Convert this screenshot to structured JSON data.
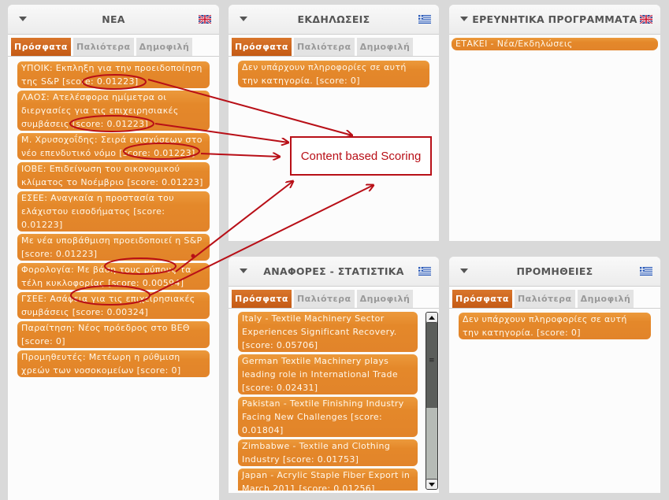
{
  "tabs": [
    "Πρόσφατα",
    "Παλιότερα",
    "Δημοφιλή"
  ],
  "colors": {
    "accent_orange": "#e4882a",
    "active_tab": "#c45a15",
    "annotation_red": "#b80f17"
  },
  "panels": {
    "news": {
      "title": "ΝΕΑ",
      "language_flag": "uk-flag",
      "items": [
        "ΥΠΟΙΚ: Εκπληξη για την προειδοποίηση της S&P [score: 0.01223]",
        "ΛΑΟΣ: Ατελέσφορα ημίμετρα οι διεργασίες για τις επιχειρησιακές συμβάσεις [score: 0.01223]",
        "Μ. Χρυσοχοΐδης: Σειρά ενισχύσεων στο νέο επενδυτικό νόμο [score: 0.01223]",
        "ΙΟΒΕ: Επιδείνωση του οικονομικού κλίματος το Νοέμβριο [score: 0.01223]",
        "ΕΣΕΕ: Αναγκαία η προστασία του ελάχιστου εισοδήματος  [score: 0.01223]",
        "Με νέα υποβάθμιση προειδοποιεί η S&P [score: 0.01223]",
        "Φορολογία: Με βάση τους ρύπους τα τέλη κυκλοφορίας [score: 0.00594]",
        "ΓΣΕΕ: Ασάφεια για τις επιχειρησιακές συμβάσεις [score: 0.00324]",
        "Παραίτηση: Νέος πρόεδρος στο ΒΕΘ [score: 0]",
        "Προμηθευτές: Μετέωρη η ρύθμιση χρεών των νοσοκομείων [score: 0]"
      ]
    },
    "events": {
      "title": "ΕΚΔΗΛΩΣΕΙΣ",
      "language_flag": "greek-flag",
      "items": [
        "Δεν υπάρχουν πληροφορίες σε αυτή την κατηγορία. [score: 0]"
      ]
    },
    "research": {
      "title": "ΕΡΕΥΝΗΤΙΚΑ ΠΡΟΓΡΑΜΜΑΤΑ",
      "language_flag": "uk-flag",
      "items": [
        "ΕΤΑΚΕΙ - Νέα/Εκδηλώσεις"
      ]
    },
    "reports": {
      "title": "ΑΝΑΦΟΡΕΣ - ΣΤΑΤΙΣΤΙΚΑ",
      "language_flag": "greek-flag",
      "items": [
        "Italy - Textile Machinery Sector Experiences Significant Recovery. [score: 0.05706]",
        "German Textile Machinery plays leading role in International Trade [score: 0.02431]",
        "Pakistan - Textile Finishing Industry Facing New Challenges [score: 0.01804]",
        "Zimbabwe - Textile and Clothing Industry [score: 0.01753]",
        "Japan - Acrylic Staple Fiber Export in March 2011 [score: 0.01256]"
      ]
    },
    "supplies": {
      "title": "ΠΡΟΜΗΘΕΙΕΣ",
      "language_flag": "greek-flag",
      "items": [
        "Δεν υπάρχουν πληροφορίες σε αυτή την κατηγορία. [score: 0]"
      ]
    }
  },
  "annotation": {
    "label": "Content based Scoring"
  }
}
